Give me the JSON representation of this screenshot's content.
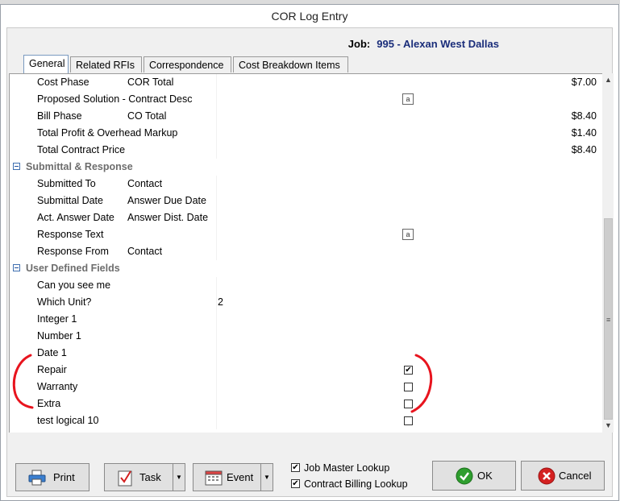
{
  "window": {
    "title": "COR Log Entry"
  },
  "job": {
    "label": "Job:",
    "value": "995 - Alexan West Dallas"
  },
  "tabs": [
    {
      "label": "General",
      "active": true
    },
    {
      "label": "Related RFIs",
      "active": false
    },
    {
      "label": "Correspondence",
      "active": false
    },
    {
      "label": "Cost Breakdown Items",
      "active": false
    }
  ],
  "rows": {
    "cost_phase": {
      "label": "Cost Phase",
      "sub": "COR Total",
      "value": "$7.00"
    },
    "proposed_solution": {
      "label": "Proposed Solution - Contract Desc",
      "icon": "a"
    },
    "bill_phase": {
      "label": "Bill Phase",
      "sub": "CO Total",
      "value": "$8.40"
    },
    "profit_markup": {
      "label": "Total Profit & Overhead Markup",
      "value": "$1.40"
    },
    "contract_price": {
      "label": "Total Contract Price",
      "value": "$8.40"
    },
    "submittal_group": {
      "label": "Submittal & Response"
    },
    "submitted_to": {
      "label": "Submitted To",
      "sub": "Contact"
    },
    "submittal_date": {
      "label": "Submittal Date",
      "sub": "Answer Due Date"
    },
    "act_answer": {
      "label": "Act. Answer Date",
      "sub": "Answer Dist. Date"
    },
    "response_text": {
      "label": "Response Text",
      "icon": "a"
    },
    "response_from": {
      "label": "Response From",
      "sub": "Contact"
    },
    "udf_group": {
      "label": "User Defined Fields"
    },
    "can_you_see": {
      "label": "Can you see me"
    },
    "which_unit": {
      "label": "Which Unit?",
      "value": "2"
    },
    "integer1": {
      "label": "Integer 1"
    },
    "number1": {
      "label": "Number 1"
    },
    "date1": {
      "label": "Date 1"
    },
    "repair": {
      "label": "Repair",
      "check": "✔"
    },
    "warranty": {
      "label": "Warranty",
      "check": ""
    },
    "extra": {
      "label": "Extra",
      "check": ""
    },
    "logical10": {
      "label": "test logical 10",
      "check": ""
    }
  },
  "buttons": {
    "print": "Print",
    "task": "Task",
    "event": "Event",
    "ok": "OK",
    "cancel": "Cancel"
  },
  "options": {
    "job_master": {
      "label": "Job Master Lookup",
      "check": "✔"
    },
    "contract_billing": {
      "label": "Contract Billing Lookup",
      "check": "✔"
    }
  },
  "icons": {
    "print": "printer-icon",
    "task": "task-checklist-icon",
    "event": "calendar-icon",
    "ok": "ok-check-icon",
    "cancel": "cancel-x-icon"
  },
  "colors": {
    "job_value": "#1a2d7a",
    "annotation": "#e8141e",
    "group_text": "#6d6d6d",
    "ok_green": "#2e9e2e",
    "cancel_red": "#d42020"
  }
}
